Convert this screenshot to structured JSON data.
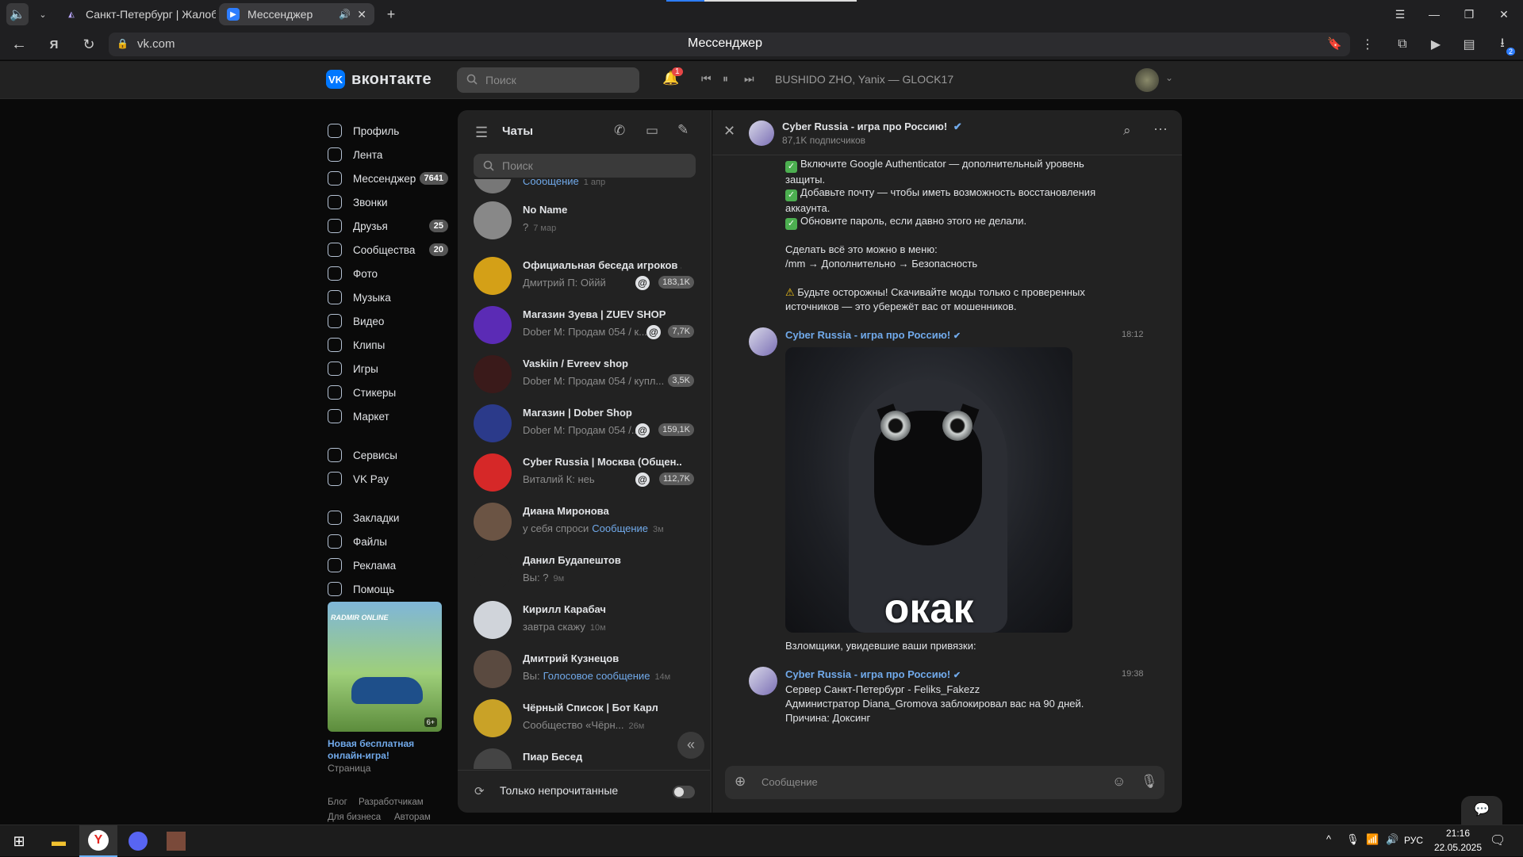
{
  "browser": {
    "tabs": [
      {
        "title": "Санкт-Петербург | Жалобы"
      },
      {
        "title": "Мессенджер"
      }
    ],
    "url": "vk.com",
    "page_title": "Мессенджер",
    "downloads_badge": "2"
  },
  "vk_header": {
    "logo_text": "вконтакте",
    "logo_mark": "VK",
    "search_placeholder": "Поиск",
    "notifications_count": "1",
    "now_playing": "BUSHIDO ZHO, Yanix — GLOCK17"
  },
  "left_nav": {
    "items": [
      {
        "label": "Профиль",
        "count": ""
      },
      {
        "label": "Лента",
        "count": ""
      },
      {
        "label": "Мессенджер",
        "count": "7641"
      },
      {
        "label": "Звонки",
        "count": ""
      },
      {
        "label": "Друзья",
        "count": "25"
      },
      {
        "label": "Сообщества",
        "count": "20"
      },
      {
        "label": "Фото",
        "count": ""
      },
      {
        "label": "Музыка",
        "count": ""
      },
      {
        "label": "Видео",
        "count": ""
      },
      {
        "label": "Клипы",
        "count": ""
      },
      {
        "label": "Игры",
        "count": ""
      },
      {
        "label": "Стикеры",
        "count": ""
      },
      {
        "label": "Маркет",
        "count": ""
      },
      {
        "label": "Сервисы",
        "count": ""
      },
      {
        "label": "VK Pay",
        "count": ""
      },
      {
        "label": "Закладки",
        "count": ""
      },
      {
        "label": "Файлы",
        "count": ""
      },
      {
        "label": "Реклама",
        "count": ""
      },
      {
        "label": "Помощь",
        "count": ""
      }
    ],
    "ad": {
      "brand": "RADMIR ONLINE",
      "age": "6+",
      "title": "Новая бесплатная онлайн-игра!",
      "subtitle": "Страница"
    },
    "footer_links": [
      "Блог",
      "Разработчикам",
      "Для бизнеса",
      "Авторам"
    ]
  },
  "chats": {
    "title": "Чаты",
    "search_placeholder": "Поиск",
    "only_unread_label": "Только непрочитанные",
    "items": [
      {
        "name": "",
        "preview_blue": "Сообщение",
        "preview": "",
        "time": "1 апр",
        "badge": "",
        "avatar_color": "#777"
      },
      {
        "name": "No Name",
        "preview_blue": "",
        "preview": "?",
        "time": "7 мар",
        "badge": "",
        "avatar_color": "#888"
      },
      {
        "name": "Официальная беседа игроков ...",
        "preview_blue": "",
        "preview": "Дмитрий П: Оййй",
        "time": "",
        "badge": "183,1K",
        "avatar_color": "#d4a017"
      },
      {
        "name": "Магазин Зуева | ZUEV SHOP",
        "preview_blue": "",
        "preview": "Dober M: Продам 054 / к...",
        "time": "",
        "badge": "7,7K",
        "avatar_color": "#5b2bb5"
      },
      {
        "name": "Vaskiin / Evreev shop",
        "preview_blue": "",
        "preview": "Dober M: Продам 054 / купл...",
        "time": "",
        "badge": "3,5K",
        "avatar_color": "#3a1a1a"
      },
      {
        "name": "Магазин | Dober Shop",
        "preview_blue": "",
        "preview": "Dober M: Продам 054 /...",
        "time": "",
        "badge": "159,1K",
        "avatar_color": "#2b3a8a"
      },
      {
        "name": "Cyber Russia | Москва (Общен...",
        "preview_blue": "",
        "preview": "Виталий К: нeь",
        "time": "",
        "badge": "112,7K",
        "avatar_color": "#d62828"
      },
      {
        "name": "Диана Миронова",
        "preview_blue": "Сообщение",
        "preview": "у себя спроси",
        "time": "3м",
        "badge": "",
        "avatar_color": "#6b5444"
      },
      {
        "name": "Данил Будапештов",
        "preview_blue": "",
        "preview": "Вы: ?",
        "time": "9м",
        "badge": "",
        "avatar_color": "#222"
      },
      {
        "name": "Кирилл Карабач",
        "preview_blue": "",
        "preview": "завтра скажу",
        "time": "10м",
        "badge": "",
        "avatar_color": "#d0d4da"
      },
      {
        "name": "Дмитрий Кузнецов",
        "preview_blue": "Голосовое сообщение",
        "preview": "Вы:",
        "time": "14м",
        "badge": "",
        "avatar_color": "#5a4a40"
      },
      {
        "name": "Чёрный Список | Бот Карл",
        "preview_blue": "",
        "preview": "Сообщество «Чёрн...",
        "time": "26м",
        "badge": "",
        "avatar_color": "#c9a227"
      },
      {
        "name": "Пиар Бесед",
        "preview_blue": "",
        "preview": "",
        "time": "",
        "badge": "",
        "avatar_color": "#444"
      }
    ]
  },
  "conversation": {
    "name": "Cyber Russia - игра про Россию!",
    "subtitle": "87,1K подписчиков",
    "message1_lines": [
      "Включите Google Authenticator — дополнительный уровень защиты.",
      "Добавьте почту — чтобы иметь возможность восстановления аккаунта.",
      "Обновите пароль, если давно этого не делали.",
      "Сделать всё это можно в меню:",
      "/mm → Дополнительно → Безопасность",
      "Будьте осторожны! Скачивайте моды только с проверенных источников — это убережёт вас от мошенников."
    ],
    "message2": {
      "sender": "Cyber Russia - игра про Россию!",
      "time": "18:12",
      "image_caption": "окак",
      "text": "Взломщики, увидевшие ваши привязки:"
    },
    "message3": {
      "sender": "Cyber Russia - игра про Россию!",
      "time": "19:38",
      "lines": [
        "Сервер Санкт-Петербург - Feliks_Fakezz",
        "Администратор Diana_Gromova заблокировал вас на 90 дней.",
        "Причина: Доксинг"
      ]
    },
    "input_placeholder": "Сообщение"
  },
  "taskbar": {
    "lang": "РУС",
    "time": "21:16",
    "date": "22.05.2025"
  },
  "colors": {
    "accent": "#71aaeb",
    "vk_blue": "#0077ff",
    "panel": "#222222"
  }
}
